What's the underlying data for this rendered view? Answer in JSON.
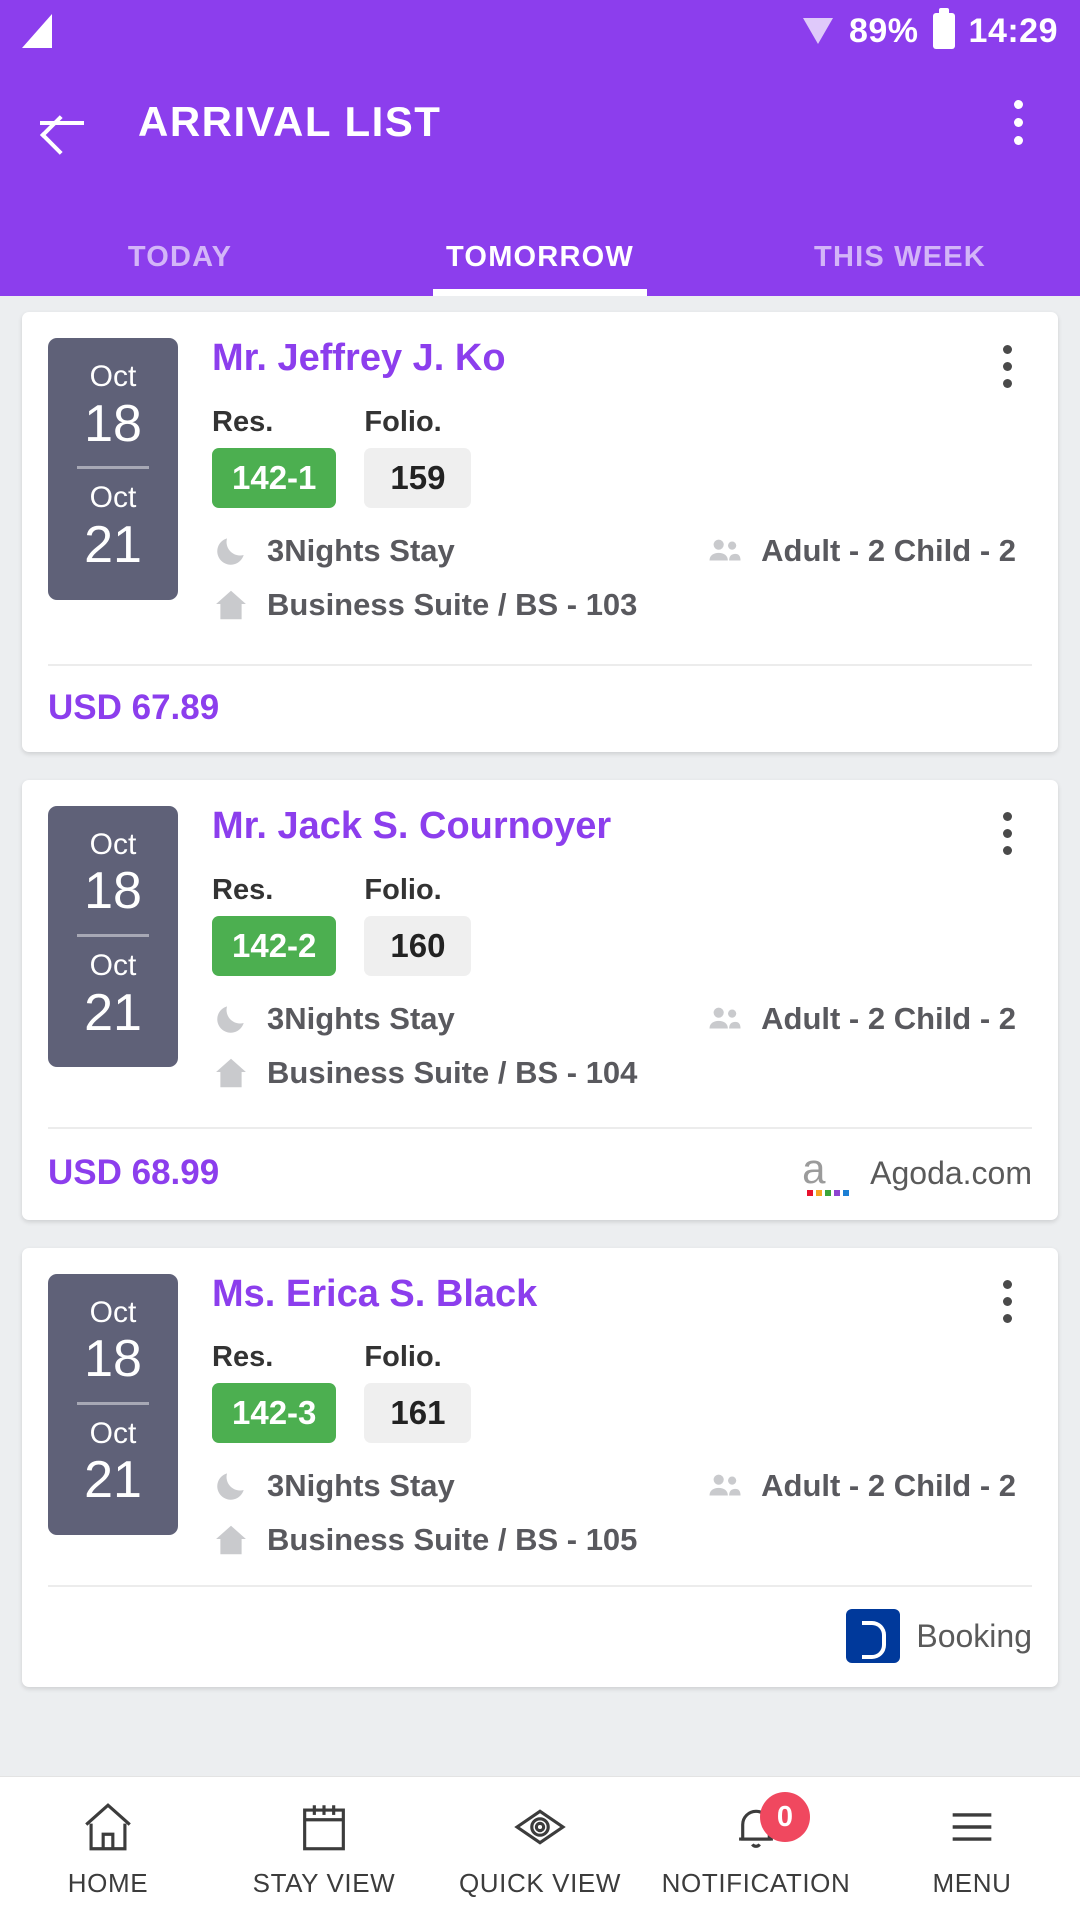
{
  "statusbar": {
    "battery_percent": "89%",
    "time": "14:29",
    "signal_icon": "signal-triangle-icon",
    "wifi_icon": "wifi-icon",
    "battery_icon": "battery-icon"
  },
  "appbar": {
    "title": "ARRIVAL LIST",
    "back_icon": "back-arrow-icon",
    "overflow_icon": "overflow-menu-icon",
    "accent_color": "#8c3eed"
  },
  "tabs": [
    {
      "label": "TODAY",
      "active": false
    },
    {
      "label": "TOMORROW",
      "active": true
    },
    {
      "label": "THIS WEEK",
      "active": false
    }
  ],
  "card_labels": {
    "res": "Res.",
    "folio": "Folio."
  },
  "cards": [
    {
      "check_in_month": "Oct",
      "check_in_day": "18",
      "check_out_month": "Oct",
      "check_out_day": "21",
      "guest": "Mr. Jeffrey J. Ko",
      "res_no": "142-1",
      "folio_no": "159",
      "nights": "3Nights Stay",
      "occupancy": "Adult - 2 Child - 2",
      "room": "Business Suite / BS - 103",
      "price": "USD 67.89",
      "source": ""
    },
    {
      "check_in_month": "Oct",
      "check_in_day": "18",
      "check_out_month": "Oct",
      "check_out_day": "21",
      "guest": "Mr. Jack S. Cournoyer",
      "res_no": "142-2",
      "folio_no": "160",
      "nights": "3Nights Stay",
      "occupancy": "Adult - 2 Child - 2",
      "room": "Business Suite / BS - 104",
      "price": "USD 68.99",
      "source": "Agoda.com"
    },
    {
      "check_in_month": "Oct",
      "check_in_day": "18",
      "check_out_month": "Oct",
      "check_out_day": "21",
      "guest": "Ms. Erica S. Black",
      "res_no": "142-3",
      "folio_no": "161",
      "nights": "3Nights Stay",
      "occupancy": "Adult - 2 Child - 2",
      "room": "Business Suite / BS - 105",
      "price": "",
      "source": "Booking"
    }
  ],
  "colors": {
    "purple": "#8c3eed",
    "green_badge": "#4caf50",
    "date_block": "#5f6178",
    "folio_badge": "#efefef",
    "badge_red": "#f0485f"
  },
  "bottomnav": [
    {
      "label": "HOME",
      "icon": "home-icon",
      "badge": ""
    },
    {
      "label": "STAY VIEW",
      "icon": "calendar-icon",
      "badge": ""
    },
    {
      "label": "QUICK VIEW",
      "icon": "eye-icon",
      "badge": ""
    },
    {
      "label": "NOTIFICATION",
      "icon": "bell-icon",
      "badge": "0"
    },
    {
      "label": "MENU",
      "icon": "hamburger-icon",
      "badge": ""
    }
  ]
}
